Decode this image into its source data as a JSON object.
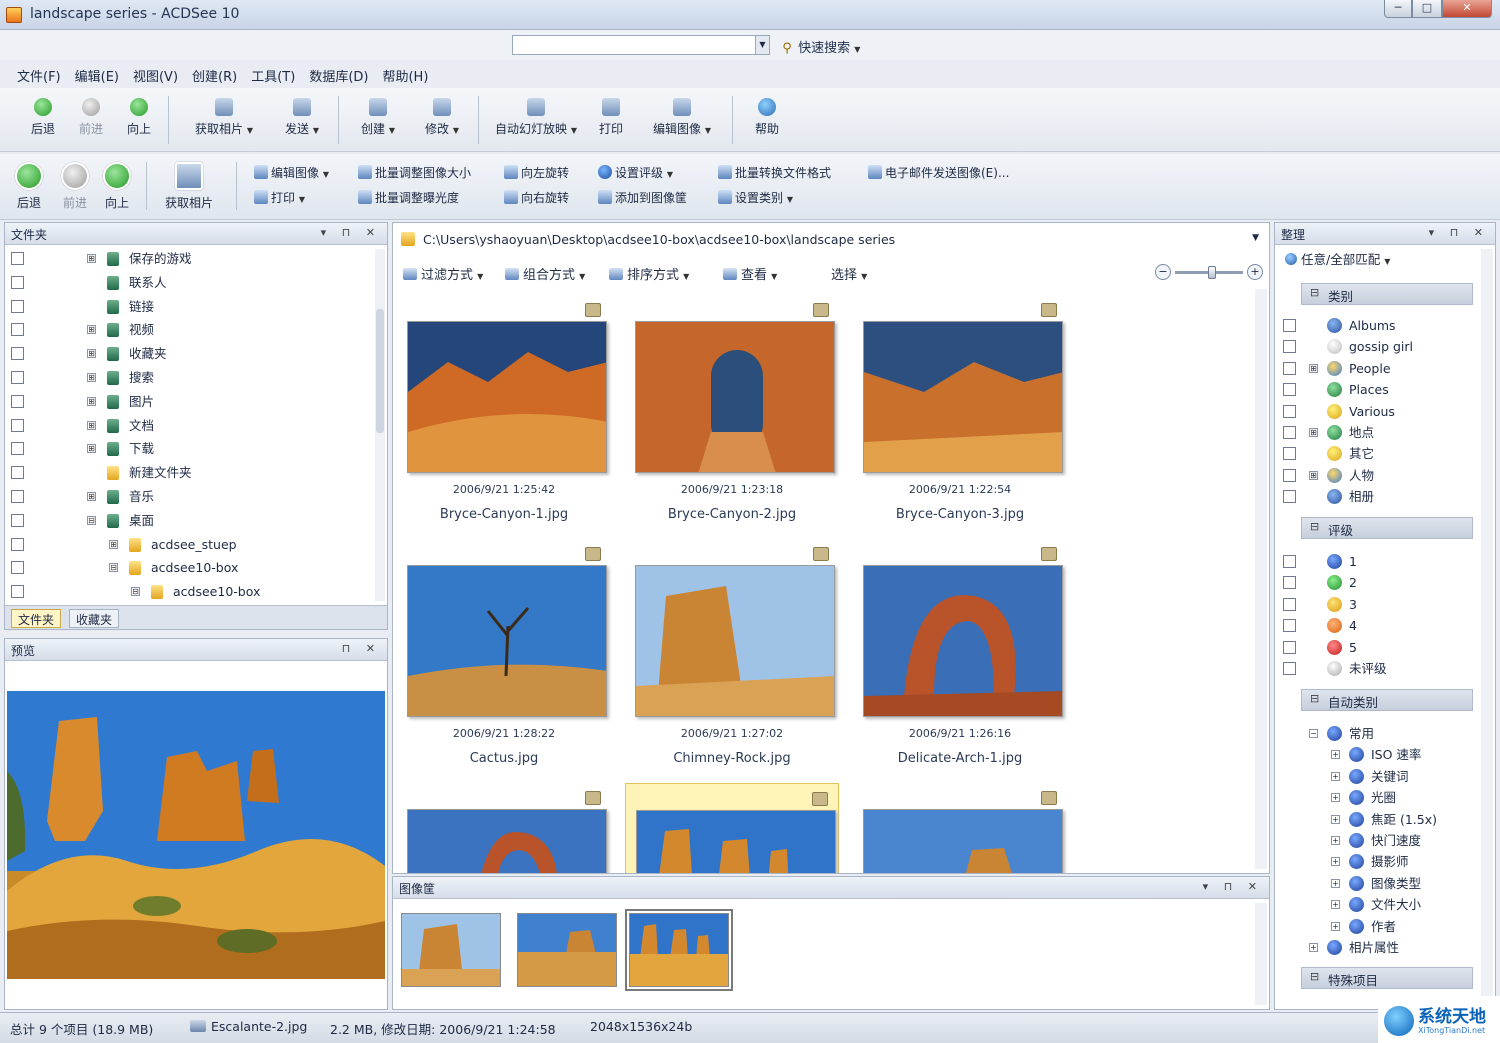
{
  "window": {
    "title": "landscape series - ACDSee 10",
    "min": "─",
    "max": "□",
    "close": "✕"
  },
  "search": {
    "placeholder": "",
    "label": "快速搜索",
    "drop": "▼"
  },
  "menu": [
    "文件(F)",
    "编辑(E)",
    "视图(V)",
    "创建(R)",
    "工具(T)",
    "数据库(D)",
    "帮助(H)"
  ],
  "toolbar1": {
    "back": "后退",
    "forward": "前进",
    "up": "向上",
    "acquire": "获取相片",
    "send": "发送",
    "create": "创建",
    "edit": "修改",
    "slideshow": "自动幻灯放映",
    "print": "打印",
    "edit_image": "编辑图像",
    "help": "帮助"
  },
  "toolbar2": {
    "back": "后退",
    "forward": "前进",
    "up": "向上",
    "acquire": "获取相片",
    "edit_image": "编辑图像",
    "print": "打印",
    "batch_resize": "批量调整图像大小",
    "batch_exposure": "批量调整曝光度",
    "rotate_left": "向左旋转",
    "rotate_right": "向右旋转",
    "set_rating": "设置评级",
    "add_basket": "添加到图像筐",
    "batch_convert": "批量转换文件格式",
    "set_category": "设置类别",
    "email": "电子邮件发送图像(E)..."
  },
  "folders": {
    "title": "文件夹",
    "items": [
      {
        "label": "保存的游戏",
        "expand": "⊞"
      },
      {
        "label": "联系人",
        "expand": ""
      },
      {
        "label": "链接",
        "expand": ""
      },
      {
        "label": "视频",
        "expand": "⊞"
      },
      {
        "label": "收藏夹",
        "expand": "⊞"
      },
      {
        "label": "搜索",
        "expand": "⊞"
      },
      {
        "label": "图片",
        "expand": "⊞"
      },
      {
        "label": "文档",
        "expand": "⊞"
      },
      {
        "label": "下载",
        "expand": "⊞"
      },
      {
        "label": "新建文件夹",
        "expand": ""
      },
      {
        "label": "音乐",
        "expand": "⊞"
      },
      {
        "label": "桌面",
        "expand": "⊟"
      },
      {
        "label": "acdsee_stuep",
        "expand": "⊞"
      },
      {
        "label": "acdsee10-box",
        "expand": "⊟"
      },
      {
        "label": "acdsee10-box",
        "expand": "⊟"
      }
    ],
    "tabs": [
      "文件夹",
      "收藏夹"
    ]
  },
  "preview": {
    "title": "预览"
  },
  "filelist": {
    "path": "C:\\Users\\yshaoyuan\\Desktop\\acdsee10-box\\acdsee10-box\\landscape series",
    "filter": "过滤方式",
    "group": "组合方式",
    "sort": "排序方式",
    "view": "查看",
    "select": "选择",
    "zoom_minus": "−",
    "zoom_plus": "+",
    "zoom_level": 0.55,
    "files": [
      {
        "date": "2006/9/21 1:25:42",
        "name": "Bryce-Canyon-1.jpg"
      },
      {
        "date": "2006/9/21 1:23:18",
        "name": "Bryce-Canyon-2.jpg"
      },
      {
        "date": "2006/9/21 1:22:54",
        "name": "Bryce-Canyon-3.jpg"
      },
      {
        "date": "2006/9/21 1:28:22",
        "name": "Cactus.jpg"
      },
      {
        "date": "2006/9/21 1:27:02",
        "name": "Chimney-Rock.jpg"
      },
      {
        "date": "2006/9/21 1:26:16",
        "name": "Delicate-Arch-1.jpg"
      }
    ]
  },
  "basket": {
    "title": "图像筐"
  },
  "organize": {
    "title": "整理",
    "match": "任意/全部匹配",
    "categories_title": "类别",
    "categories": [
      {
        "label": "Albums",
        "expand": ""
      },
      {
        "label": "gossip girl",
        "expand": ""
      },
      {
        "label": "People",
        "expand": "⊞"
      },
      {
        "label": "Places",
        "expand": ""
      },
      {
        "label": "Various",
        "expand": ""
      },
      {
        "label": "地点",
        "expand": "⊞"
      },
      {
        "label": "其它",
        "expand": ""
      },
      {
        "label": "人物",
        "expand": "⊞"
      },
      {
        "label": "相册",
        "expand": ""
      }
    ],
    "ratings_title": "评级",
    "ratings": [
      "1",
      "2",
      "3",
      "4",
      "5",
      "未评级"
    ],
    "auto_title": "自动类别",
    "auto_parent": "常用",
    "auto_items": [
      "ISO 速率",
      "关键词",
      "光圈",
      "焦距 (1.5x)",
      "快门速度",
      "摄影师",
      "图像类型",
      "文件大小",
      "作者"
    ],
    "photo_props": "相片属性",
    "special_title": "特殊项目"
  },
  "status": {
    "total": "总计 9 个项目 (18.9 MB)",
    "file": "Escalante-2.jpg",
    "info": "2.2 MB, 修改日期: 2006/9/21 1:24:58",
    "dims": "2048x1536x24b"
  },
  "watermark": {
    "main": "系统天地",
    "sub": "XiTongTianDi.net"
  },
  "colors": {
    "accent": "#2f6fbf",
    "selection": "#fff4b8",
    "panel_header": "#d6deea"
  }
}
